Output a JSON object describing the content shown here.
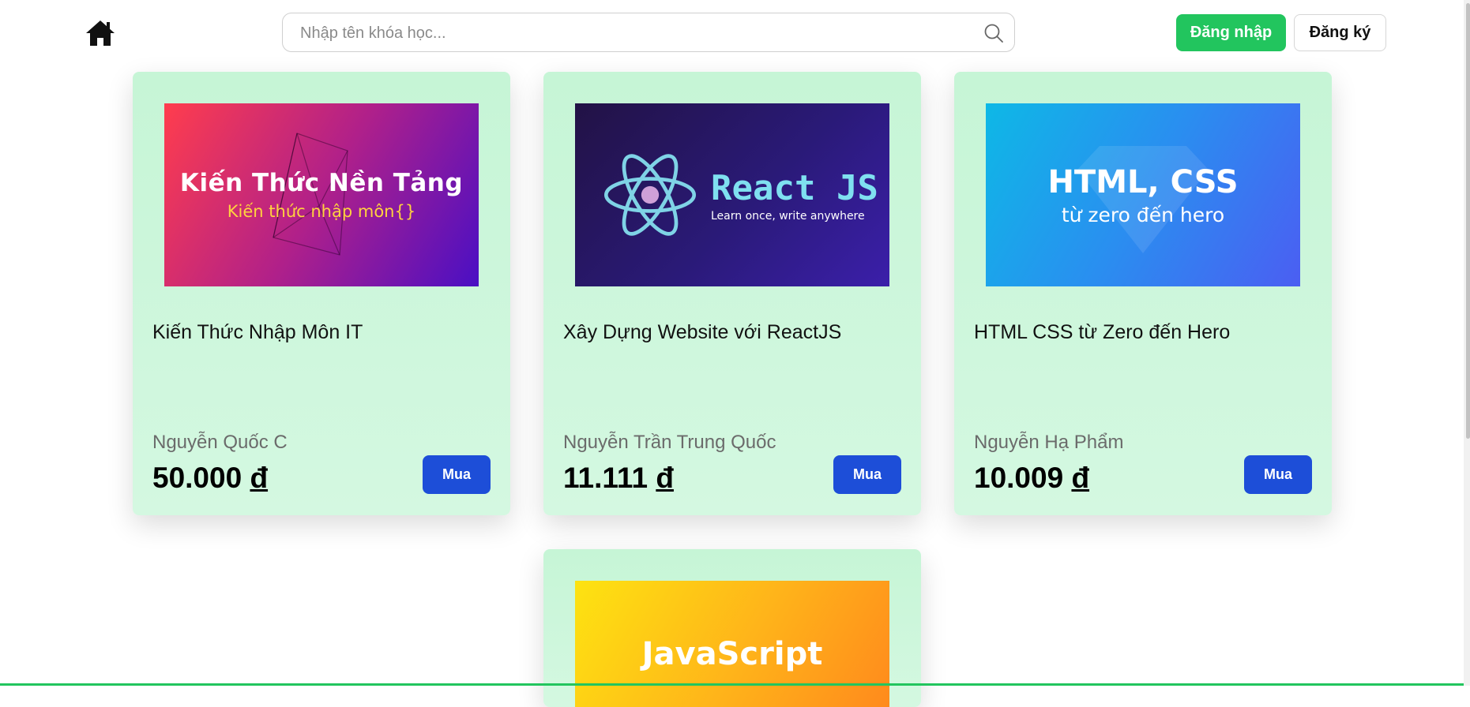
{
  "header": {
    "search_placeholder": "Nhập tên khóa học...",
    "login_label": "Đăng nhập",
    "register_label": "Đăng ký"
  },
  "courses": [
    {
      "thumb_title": "Kiến Thức Nền Tảng",
      "thumb_subtitle": "Kiến thức nhập môn{}",
      "name": "Kiến Thức Nhập Môn IT",
      "author": "Nguyễn Quốc C",
      "price": "50.000",
      "currency": "đ",
      "buy_label": "Mua"
    },
    {
      "thumb_title": "React JS",
      "thumb_subtitle": "Learn once, write anywhere",
      "name": "Xây Dựng Website với ReactJS",
      "author": "Nguyễn Trần Trung Quốc",
      "price": "11.111",
      "currency": "đ",
      "buy_label": "Mua"
    },
    {
      "thumb_title": "HTML, CSS",
      "thumb_subtitle": "từ zero đến hero",
      "name": "HTML CSS từ Zero đến Hero",
      "author": "Nguyễn Hạ Phẩm",
      "price": "10.009",
      "currency": "đ",
      "buy_label": "Mua"
    },
    {
      "thumb_title": "JavaScript"
    }
  ],
  "colors": {
    "primary_green": "#22c55e",
    "buy_blue": "#1d4ed8",
    "card_bg": "#c6f5d6"
  }
}
